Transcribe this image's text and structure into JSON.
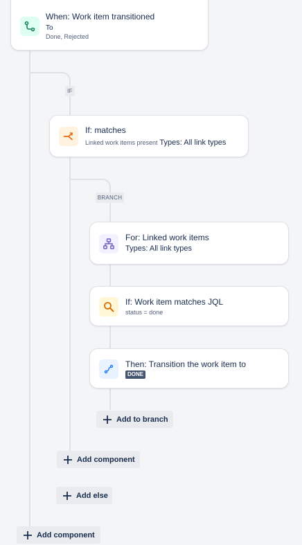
{
  "trigger": {
    "title": "When: Work item transitioned",
    "to_label": "To",
    "to_values": "Done, Rejected",
    "icon": "transition-icon"
  },
  "if_tag": "IF",
  "condition": {
    "title": "If: matches",
    "detail_small": "Linked work items present",
    "detail_strong": "Types: All link types",
    "icon": "branch-condition-icon"
  },
  "branch_tag": "BRANCH",
  "branch_card": {
    "title": "For: Linked work items",
    "subtitle": "Types: All link types",
    "icon": "hierarchy-icon"
  },
  "jql_card": {
    "title": "If: Work item matches JQL",
    "subtitle": "status = done",
    "icon": "search-icon"
  },
  "action_card": {
    "title": "Then: Transition the work item to",
    "status_lozenge": "DONE",
    "icon": "transition-action-icon"
  },
  "buttons": {
    "add_to_branch": "Add to branch",
    "add_component_inner": "Add component",
    "add_else": "Add else",
    "add_component_outer": "Add component"
  },
  "colors": {
    "trigger_icon_bg": "#dcfff1",
    "trigger_icon": "#1f845a",
    "condition_icon_bg": "#fff3e0",
    "condition_icon": "#e56910",
    "branch_icon_bg": "#f3f0ff",
    "branch_icon": "#6e5dc6",
    "jql_icon_bg": "#fff7d6",
    "jql_icon": "#d97008",
    "action_icon_bg": "#e9f2ff",
    "action_icon": "#1d7afc",
    "lozenge_bg": "#44546f"
  }
}
